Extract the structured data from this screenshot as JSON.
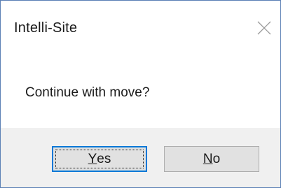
{
  "dialog": {
    "title": "Intelli-Site",
    "message": "Continue with move?",
    "close_icon": "close-icon",
    "buttons": {
      "yes": {
        "mnemonic": "Y",
        "rest": "es"
      },
      "no": {
        "mnemonic": "N",
        "rest": "o"
      }
    },
    "colors": {
      "border": "#5a7fb5",
      "footer_bg": "#f0f0f0",
      "button_bg": "#e1e1e1",
      "default_button_border": "#0078d7"
    }
  }
}
